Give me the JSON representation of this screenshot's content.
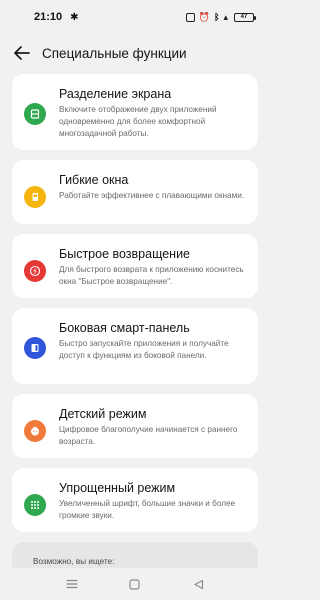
{
  "status_bar": {
    "time": "21:10",
    "battery": "47"
  },
  "header": {
    "title": "Специальные функции"
  },
  "items": [
    {
      "title": "Разделение экрана",
      "desc": "Включите отображение двух приложений одновременно для более комфортной многозадачной работы.",
      "icon": "split-screen-icon",
      "color": "#2fa84f"
    },
    {
      "title": "Гибкие окна",
      "desc": "Работайте эффективнее с плавающими окнами.",
      "icon": "flexible-window-icon",
      "color": "#f6b40e"
    },
    {
      "title": "Быстрое возвращение",
      "desc": "Для быстрого возврата к приложению коснитесь окна \"Быстрое возвращение\".",
      "icon": "lightning-icon",
      "color": "#e53935"
    },
    {
      "title": "Боковая смарт-панель",
      "desc": "Быстро запускайте приложения и получайте доступ к функциям из боковой панели.",
      "icon": "sidebar-panel-icon",
      "color": "#2f56d9"
    },
    {
      "title": "Детский режим",
      "desc": "Цифровое благополучие начинается с раннего возраста.",
      "icon": "kid-face-icon",
      "color": "#f07a3a"
    },
    {
      "title": "Упрощенный режим",
      "desc": "Увеличенный шрифт, большие значки и более громкие звуки.",
      "icon": "grid-dots-icon",
      "color": "#2fa84f"
    }
  ],
  "suggestions": {
    "label": "Возможно, вы ищете:"
  }
}
